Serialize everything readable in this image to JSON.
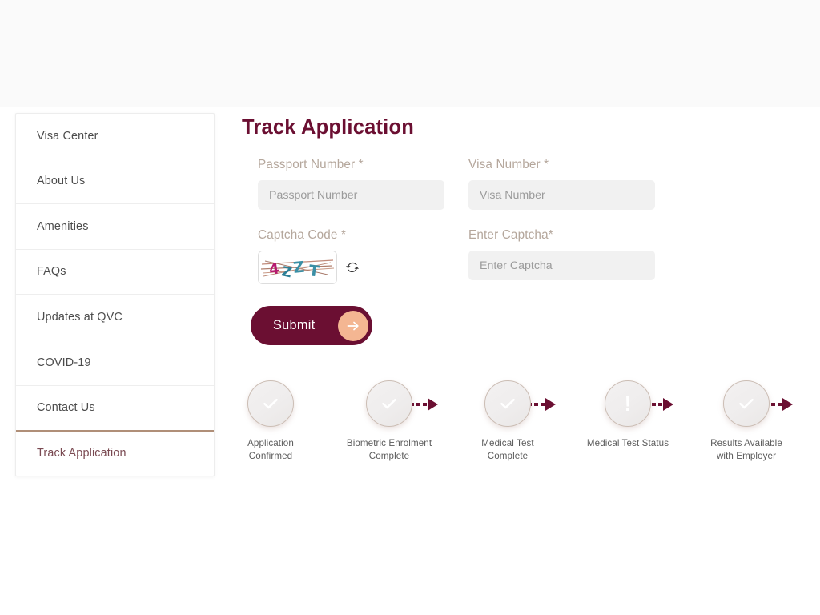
{
  "sidebar": {
    "items": [
      {
        "label": "Visa Center",
        "active": false
      },
      {
        "label": "About Us",
        "active": false
      },
      {
        "label": "Amenities",
        "active": false
      },
      {
        "label": "FAQs",
        "active": false
      },
      {
        "label": "Updates at QVC",
        "active": false
      },
      {
        "label": "COVID-19",
        "active": false
      },
      {
        "label": "Contact Us",
        "active": false
      },
      {
        "label": "Track Application",
        "active": true
      }
    ]
  },
  "main": {
    "title": "Track Application",
    "form": {
      "passport": {
        "label": "Passport Number *",
        "placeholder": "Passport Number",
        "value": ""
      },
      "visa": {
        "label": "Visa Number *",
        "placeholder": "Visa Number",
        "value": ""
      },
      "captcha_code": {
        "label": "Captcha Code *",
        "image_text": "4ZZT",
        "refresh_icon": "refresh-icon"
      },
      "enter_captcha": {
        "label": "Enter Captcha*",
        "placeholder": "Enter Captcha",
        "value": ""
      },
      "submit": {
        "label": "Submit",
        "arrow_icon": "arrow-right-icon"
      }
    }
  },
  "stepper": {
    "steps": [
      {
        "label": "Application\nConfirmed",
        "line1": "Application",
        "line2": "Confirmed",
        "icon": "check-icon"
      },
      {
        "label": "Biometric Enrolment\nComplete",
        "line1": "Biometric Enrolment",
        "line2": "Complete",
        "icon": "check-icon"
      },
      {
        "label": "Medical Test\nComplete",
        "line1": "Medical Test",
        "line2": "Complete",
        "icon": "check-icon"
      },
      {
        "label": "Medical Test Status",
        "line1": "Medical Test Status",
        "line2": "",
        "icon": "exclamation-icon"
      },
      {
        "label": "Results Available\nwith Employer",
        "line1": "Results Available",
        "line2": "with Employer",
        "icon": "check-icon"
      }
    ],
    "connector_count": 4
  },
  "colors": {
    "brand_maroon": "#6b0f32",
    "accent_peach": "#f4b692",
    "label_tan": "#b5a79c",
    "active_border": "#b08f78",
    "input_bg": "#f1f1f1",
    "page_bg": "#ffffff",
    "top_band_bg": "#fafafa"
  }
}
